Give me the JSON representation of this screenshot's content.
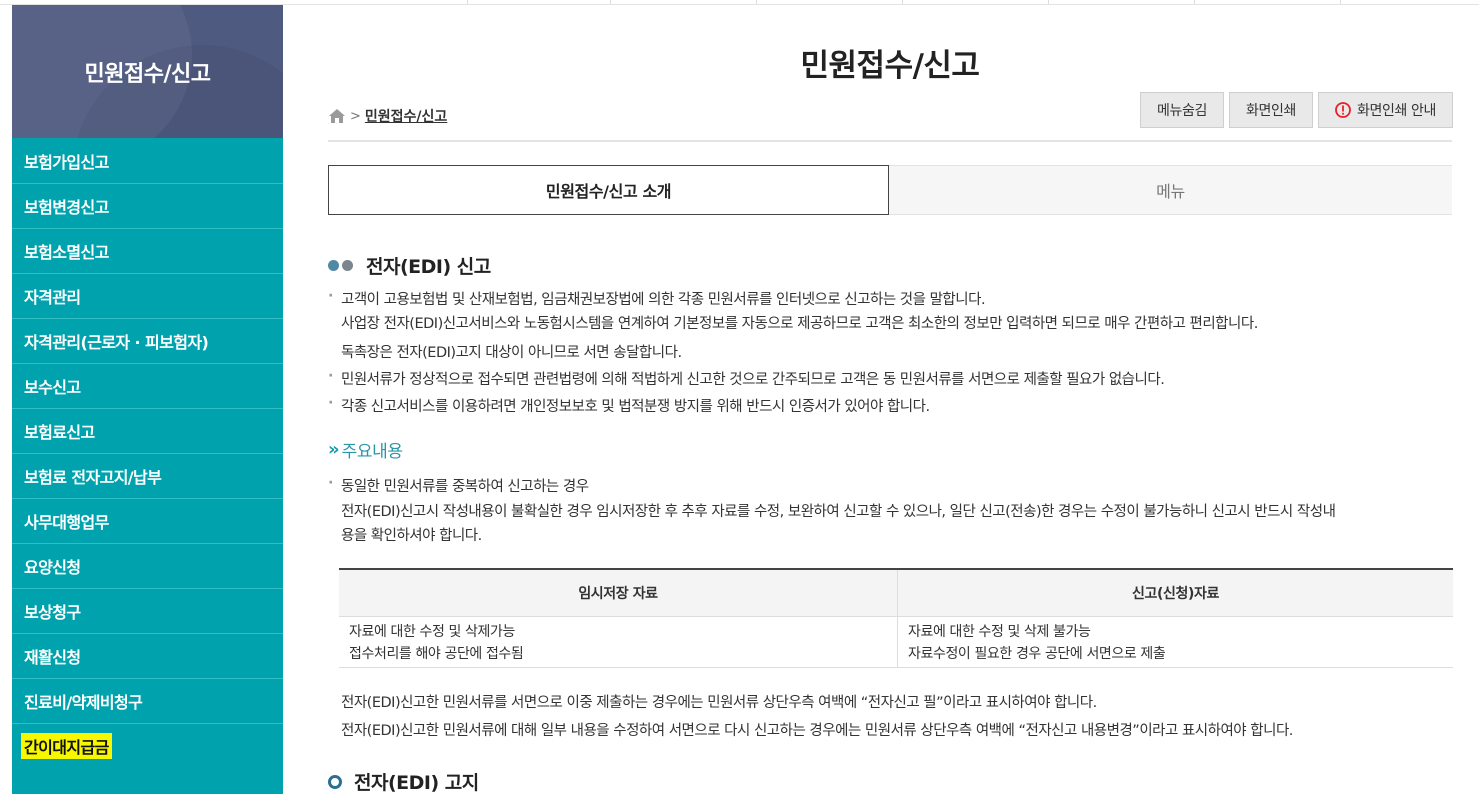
{
  "sidebar": {
    "title": "민원접수/신고",
    "items": [
      {
        "label": "보험가입신고"
      },
      {
        "label": "보험변경신고"
      },
      {
        "label": "보험소멸신고"
      },
      {
        "label": "자격관리"
      },
      {
        "label": "자격관리(근로자 · 피보험자)"
      },
      {
        "label": "보수신고"
      },
      {
        "label": "보험료신고"
      },
      {
        "label": "보험료 전자고지/납부"
      },
      {
        "label": "사무대행업무"
      },
      {
        "label": "요양신청"
      },
      {
        "label": "보상청구"
      },
      {
        "label": "재활신청"
      },
      {
        "label": "진료비/약제비청구"
      },
      {
        "label": "간이대지급금",
        "highlighted": true
      }
    ],
    "colors": {
      "header": "#4f5a80",
      "background": "#00a3ad",
      "highlight": "#f7f700"
    }
  },
  "header": {
    "title": "민원접수/신고",
    "breadcrumb": {
      "home_icon": "home-icon",
      "separator": ">",
      "current": "민원접수/신고"
    },
    "buttons": {
      "hide_menu": "메뉴숨김",
      "print": "화면인쇄",
      "print_guide": "화면인쇄 안내"
    }
  },
  "tabs": [
    {
      "label": "민원접수/신고 소개",
      "active": true
    },
    {
      "label": "메뉴",
      "active": false
    }
  ],
  "section1": {
    "title": "전자(EDI) 신고",
    "paragraphs": [
      "고객이 고용보험법 및 산재보험법, 임금채권보장법에 의한 각종 민원서류를 인터넷으로 신고하는 것을 말합니다.",
      "사업장 전자(EDI)신고서비스와 노동험시스템을 연계하여 기본정보를 자동으로 제공하므로 고객은 최소한의 정보만 입력하면 되므로 매우 간편하고 편리합니다.",
      "독촉장은 전자(EDI)고지 대상이 아니므로 서면 송달합니다.",
      "민원서류가 정상적으로 접수되면 관련법령에 의해 적법하게 신고한 것으로 간주되므로 고객은 동 민원서류를 서면으로 제출할 필요가 없습니다.",
      "각종 신고서비스를 이용하려면 개인정보보호 및 법적분쟁 방지를 위해 반드시 인증서가 있어야 합니다."
    ]
  },
  "subsection": {
    "title": "주요내용",
    "lines": [
      "동일한 민원서류를 중복하여 신고하는 경우",
      "전자(EDI)신고시 작성내용이 불확실한 경우 임시저장한 후 추후 자료를 수정, 보완하여 신고할 수 있으나, 일단 신고(전송)한 경우는 수정이 불가능하니 신고시 반드시 작성내",
      "용을 확인하셔야 합니다."
    ]
  },
  "table": {
    "headers": [
      "임시저장 자료",
      "신고(신청)자료"
    ],
    "rows": [
      [
        "자료에 대한 수정 및 삭제가능",
        "자료에 대한 수정 및 삭제 불가능"
      ],
      [
        "접수처리를 해야 공단에 접수됨",
        "자료수정이 필요한 경우 공단에 서면으로 제출"
      ]
    ]
  },
  "notes": [
    "전자(EDI)신고한 민원서류를 서면으로 이중 제출하는 경우에는 민원서류 상단우측 여백에 “전자신고 필”이라고 표시하여야 합니다.",
    "전자(EDI)신고한 민원서류에 대해 일부 내용을 수정하여 서면으로 다시 신고하는 경우에는 민원서류 상단우측 여백에 “전자신고 내용변경”이라고 표시하여야 합니다."
  ],
  "section2": {
    "title": "전자(EDI) 고지"
  }
}
